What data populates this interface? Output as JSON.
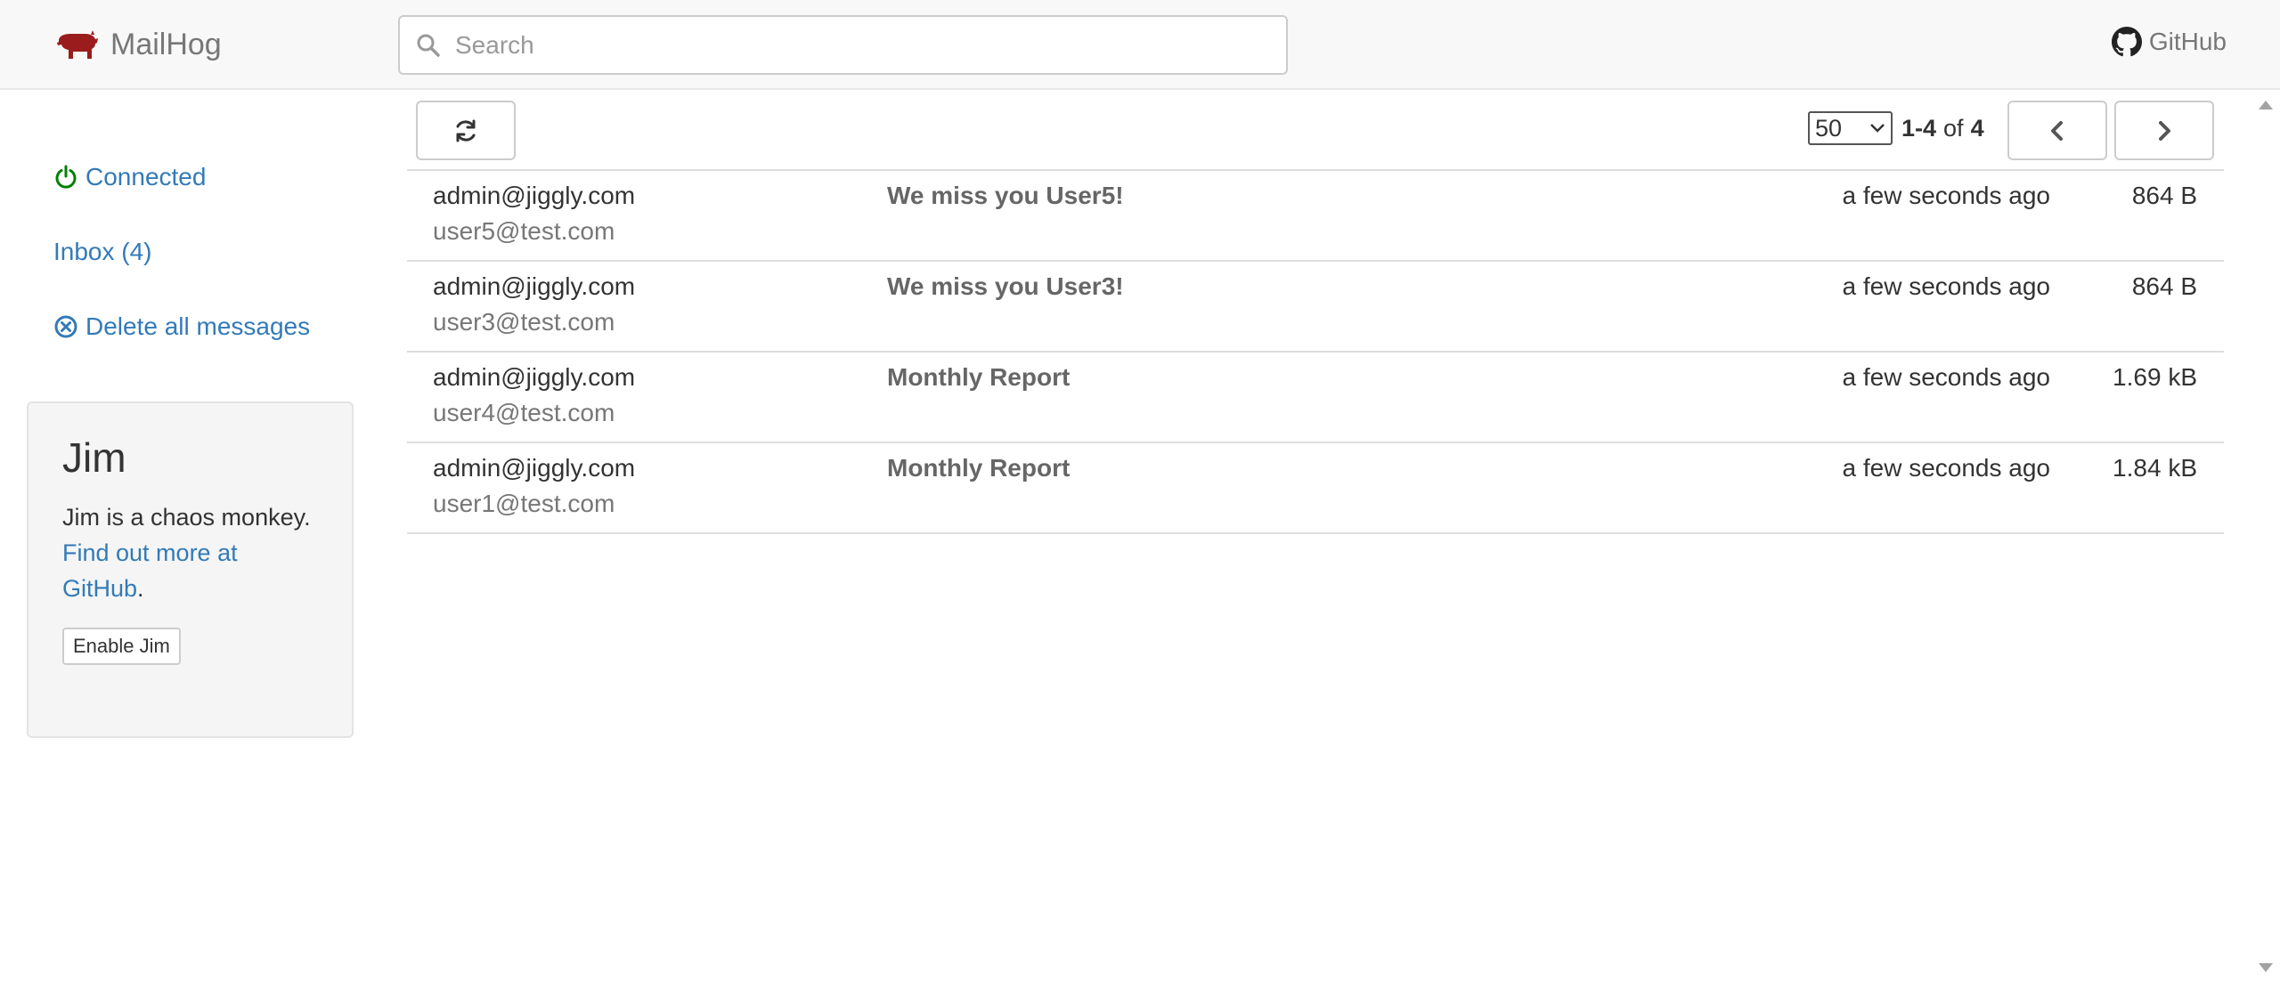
{
  "navbar": {
    "brand": "MailHog",
    "search_placeholder": "Search",
    "github_label": "GitHub"
  },
  "sidebar": {
    "connected_label": "Connected",
    "inbox_label": "Inbox (4)",
    "delete_label": "Delete all messages",
    "jim": {
      "title": "Jim",
      "description": "Jim is a chaos monkey.",
      "link_text": "Find out more at GitHub",
      "link_suffix": ".",
      "button_label": "Enable Jim"
    }
  },
  "toolbar": {
    "page_size": "50",
    "range": "1-4",
    "of_label": "of",
    "total": "4"
  },
  "messages": [
    {
      "from": "admin@jiggly.com",
      "to": "user5@test.com",
      "subject": "We miss you User5!",
      "time": "a few seconds ago",
      "size": "864 B"
    },
    {
      "from": "admin@jiggly.com",
      "to": "user3@test.com",
      "subject": "We miss you User3!",
      "time": "a few seconds ago",
      "size": "864 B"
    },
    {
      "from": "admin@jiggly.com",
      "to": "user4@test.com",
      "subject": "Monthly Report",
      "time": "a few seconds ago",
      "size": "1.69 kB"
    },
    {
      "from": "admin@jiggly.com",
      "to": "user1@test.com",
      "subject": "Monthly Report",
      "time": "a few seconds ago",
      "size": "1.84 kB"
    }
  ],
  "colors": {
    "link": "#337ab7",
    "connected": "#008000",
    "brand_pig": "#9b1c1c"
  }
}
